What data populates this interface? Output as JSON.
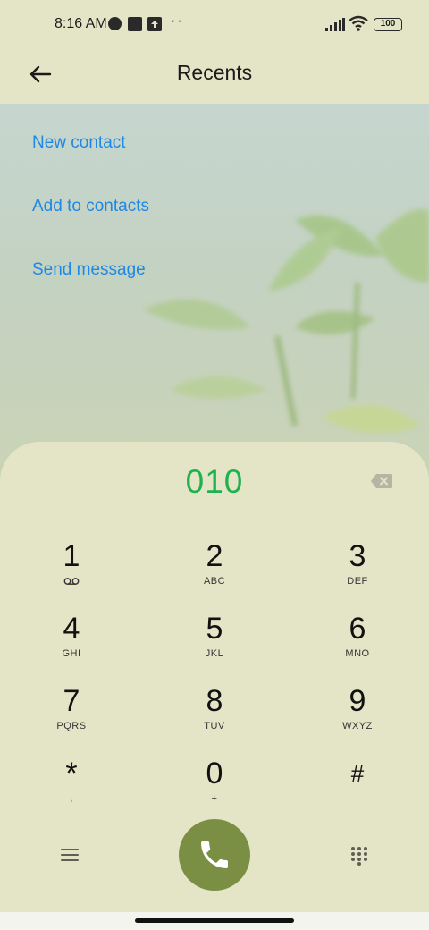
{
  "status_bar": {
    "time": "8:16 AM",
    "battery": "100",
    "icons": [
      "notification-circle-icon",
      "notification-square-icon",
      "upload-icon",
      "more-dots-icon",
      "signal-icon",
      "wifi-icon",
      "battery-icon"
    ],
    "more_dots": "··"
  },
  "header": {
    "title": "Recents",
    "back_icon": "arrow-left-icon"
  },
  "actions": [
    {
      "label": "New contact"
    },
    {
      "label": "Add to contacts"
    },
    {
      "label": "Send message"
    }
  ],
  "dialer": {
    "number": "010",
    "backspace_icon": "backspace-icon",
    "keys": [
      {
        "digit": "1",
        "letters": "",
        "icon": "voicemail-icon"
      },
      {
        "digit": "2",
        "letters": "ABC"
      },
      {
        "digit": "3",
        "letters": "DEF"
      },
      {
        "digit": "4",
        "letters": "GHI"
      },
      {
        "digit": "5",
        "letters": "JKL"
      },
      {
        "digit": "6",
        "letters": "MNO"
      },
      {
        "digit": "7",
        "letters": "PQRS"
      },
      {
        "digit": "8",
        "letters": "TUV"
      },
      {
        "digit": "9",
        "letters": "WXYZ"
      },
      {
        "digit": "*",
        "letters": ","
      },
      {
        "digit": "0",
        "letters": "+"
      },
      {
        "digit": "#",
        "letters": ""
      }
    ],
    "bottom_icons": [
      "menu-icon",
      "phone-icon",
      "dialpad-icon"
    ]
  },
  "colors": {
    "background": "#e4e4c6",
    "accent_link": "#1e88e5",
    "number": "#20b14f",
    "call_button": "#7a8f44"
  }
}
